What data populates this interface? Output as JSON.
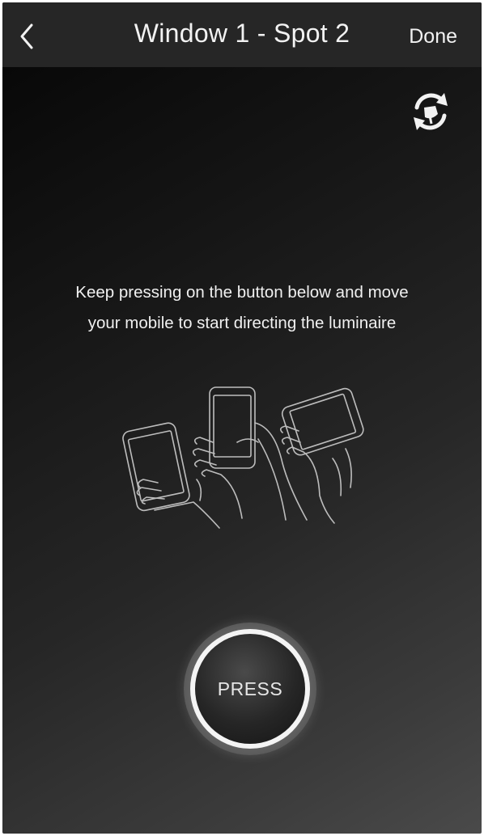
{
  "navbar": {
    "title": "Window 1 - Spot 2",
    "done_label": "Done",
    "back_icon": "chevron-left-icon"
  },
  "toolbar": {
    "reset_icon": "recalibrate-orientation-icon"
  },
  "instruction": {
    "line1": "Keep pressing on the button below and move",
    "line2": "your mobile to start directing the luminaire"
  },
  "illustration": {
    "icon": "hands-holding-phones-illustration"
  },
  "press_button": {
    "label": "PRESS"
  },
  "colors": {
    "background_dark": "#050505",
    "background_light": "#4a4a4a",
    "navbar": "#262626",
    "text": "#f2f2f2",
    "button_ring": "#f4f4f4"
  }
}
